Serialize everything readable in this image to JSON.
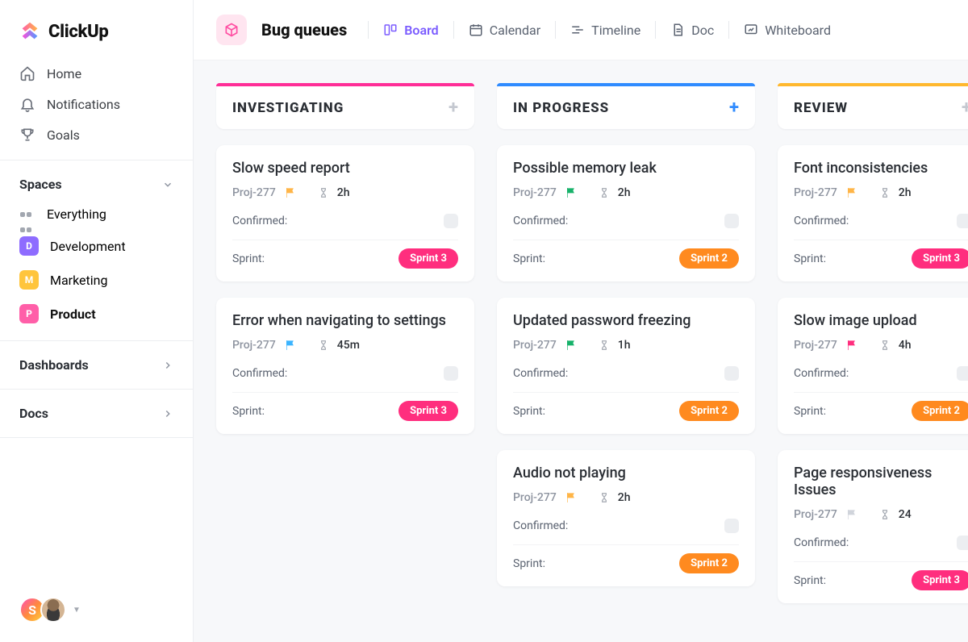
{
  "brand": {
    "name": "ClickUp"
  },
  "sidebar": {
    "nav": [
      {
        "label": "Home"
      },
      {
        "label": "Notifications"
      },
      {
        "label": "Goals"
      }
    ],
    "sections": {
      "spaces": {
        "title": "Spaces",
        "everything": "Everything",
        "items": [
          {
            "initial": "D",
            "label": "Development",
            "color": "#8e6cff"
          },
          {
            "initial": "M",
            "label": "Marketing",
            "color": "#ffc53d"
          },
          {
            "initial": "P",
            "label": "Product",
            "color": "#ff5fa8",
            "active": true
          }
        ]
      },
      "dashboards": {
        "title": "Dashboards"
      },
      "docs": {
        "title": "Docs"
      }
    },
    "avatar_initial": "S"
  },
  "header": {
    "title": "Bug queues",
    "views": [
      {
        "label": "Board",
        "active": true
      },
      {
        "label": "Calendar"
      },
      {
        "label": "Timeline"
      },
      {
        "label": "Doc"
      },
      {
        "label": "Whiteboard"
      }
    ]
  },
  "board": {
    "columns": [
      {
        "title": "INVESTIGATING",
        "accent": "pink",
        "add_color": "muted",
        "cards": [
          {
            "title": "Slow speed report",
            "proj": "Proj-277",
            "flag": "#ffb547",
            "time": "2h",
            "confirmed_label": "Confirmed:",
            "sprint_label": "Sprint:",
            "sprint": "Sprint 3",
            "sprint_color": "pink"
          },
          {
            "title": "Error when navigating to settings",
            "proj": "Proj-277",
            "flag": "#3bb4ff",
            "time": "45m",
            "confirmed_label": "Confirmed:",
            "sprint_label": "Sprint:",
            "sprint": "Sprint 3",
            "sprint_color": "pink"
          }
        ]
      },
      {
        "title": "IN PROGRESS",
        "accent": "blue",
        "add_color": "blue",
        "cards": [
          {
            "title": "Possible memory leak",
            "proj": "Proj-277",
            "flag": "#17b26a",
            "time": "2h",
            "confirmed_label": "Confirmed:",
            "sprint_label": "Sprint:",
            "sprint": "Sprint 2",
            "sprint_color": "orange"
          },
          {
            "title": "Updated password freezing",
            "proj": "Proj-277",
            "flag": "#17b26a",
            "time": "1h",
            "confirmed_label": "Confirmed:",
            "sprint_label": "Sprint:",
            "sprint": "Sprint 2",
            "sprint_color": "orange"
          },
          {
            "title": "Audio not playing",
            "proj": "Proj-277",
            "flag": "#ffb547",
            "time": "2h",
            "confirmed_label": "Confirmed:",
            "sprint_label": "Sprint:",
            "sprint": "Sprint 2",
            "sprint_color": "orange"
          }
        ]
      },
      {
        "title": "REVIEW",
        "accent": "yellow",
        "add_color": "muted",
        "cards": [
          {
            "title": "Font inconsistencies",
            "proj": "Proj-277",
            "flag": "#ffb547",
            "time": "2h",
            "confirmed_label": "Confirmed:",
            "sprint_label": "Sprint:",
            "sprint": "Sprint 3",
            "sprint_color": "pink"
          },
          {
            "title": "Slow image upload",
            "proj": "Proj-277",
            "flag": "#ff2e7e",
            "time": "4h",
            "confirmed_label": "Confirmed:",
            "sprint_label": "Sprint:",
            "sprint": "Sprint 2",
            "sprint_color": "orange"
          },
          {
            "title": "Page responsiveness Issues",
            "proj": "Proj-277",
            "flag": "#d0d4db",
            "time": "24",
            "confirmed_label": "Confirmed:",
            "sprint_label": "Sprint:",
            "sprint": "Sprint 3",
            "sprint_color": "pink"
          }
        ]
      }
    ]
  }
}
